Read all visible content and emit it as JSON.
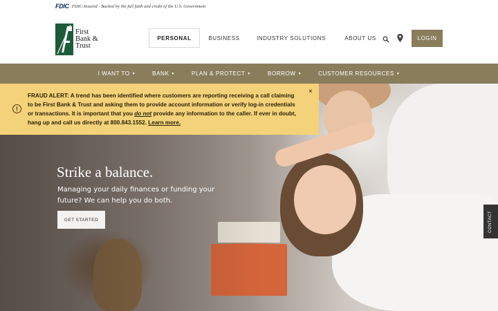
{
  "fdic": {
    "logo": "FDIC",
    "text": "FDIC-Insured - Backed by the full faith and credit of the U.S. Government"
  },
  "brand": {
    "name_line1": "First",
    "name_line2": "Bank &",
    "name_line3": "Trust",
    "color": "#1e5b3b"
  },
  "main_nav": {
    "personal": "PERSONAL",
    "business": "BUSINESS",
    "industry": "INDUSTRY SOLUTIONS",
    "about": "ABOUT US",
    "login": "LOGIN"
  },
  "icons": {
    "search": "search-icon",
    "location": "location-pin-icon",
    "alert": "exclamation-circle-icon",
    "close": "close-icon"
  },
  "sub_nav": {
    "items": [
      {
        "label": "I WANT TO"
      },
      {
        "label": "BANK"
      },
      {
        "label": "PLAN & PROTECT"
      },
      {
        "label": "BORROW"
      },
      {
        "label": "CUSTOMER RESOURCES"
      }
    ]
  },
  "alert": {
    "label": "FRAUD ALERT:",
    "text_part1": " A trend has been identified where customers are reporting receiving a call claiming to be First Bank & Trust and asking them to provide account information or verify log-in credentials or transactions. It is important that you ",
    "emphasis": "do not",
    "text_part2": " provide any information to the caller. If ever in doubt, hang up and call us directly at 800.843.1552. ",
    "link": "Learn more.",
    "close": "×"
  },
  "hero": {
    "title": "Strike a balance.",
    "subtitle": "Managing your daily finances or funding your future? We can help you do both.",
    "cta": "GET STARTED"
  },
  "contact_tab": "CONTACT",
  "colors": {
    "accent": "#8a7d5c",
    "alert_bg": "#f4d27a",
    "brand_green": "#1e5b3b"
  }
}
